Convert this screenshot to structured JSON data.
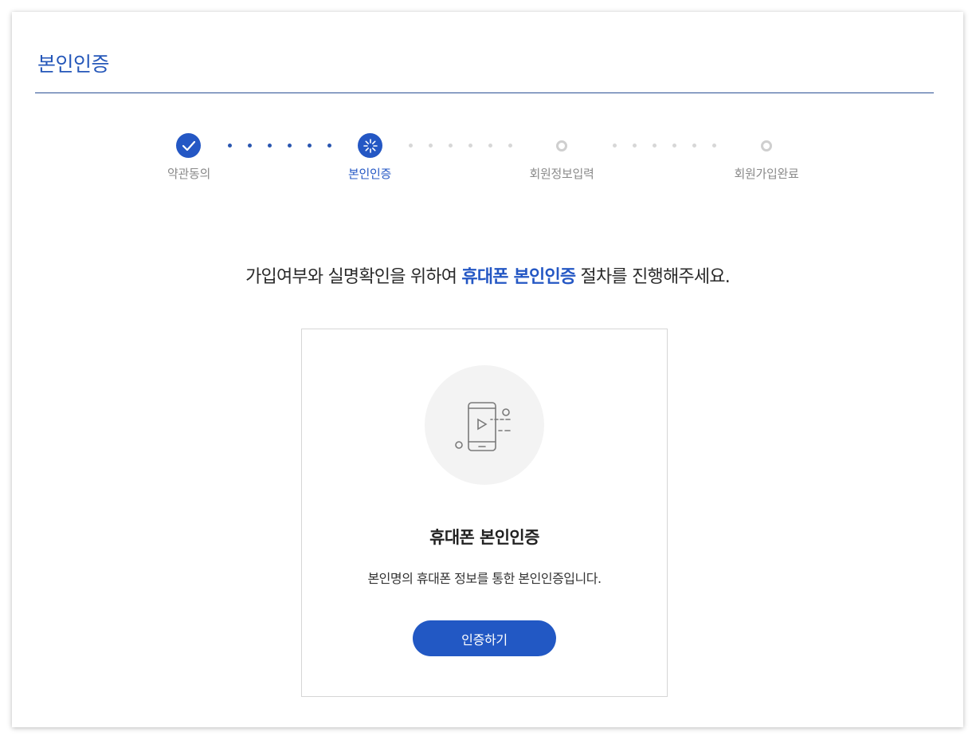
{
  "header": {
    "title": "본인인증"
  },
  "stepper": {
    "steps": [
      {
        "label": "약관동의",
        "state": "done"
      },
      {
        "label": "본인인증",
        "state": "active"
      },
      {
        "label": "회원정보입력",
        "state": "pending"
      },
      {
        "label": "회원가입완료",
        "state": "pending"
      }
    ]
  },
  "intro": {
    "before": "가입여부와 실명확인을 위하여 ",
    "highlight": "휴대폰 본인인증",
    "after": " 절차를 진행해주세요."
  },
  "card": {
    "icon": "mobile-phone-icon",
    "title": "휴대폰 본인인증",
    "description": "본인명의 휴대폰 정보를 통한 본인인증입니다.",
    "button_label": "인증하기"
  },
  "colors": {
    "accent": "#2457c4",
    "pending": "#cfcfcf",
    "text": "#2a2a2a"
  }
}
